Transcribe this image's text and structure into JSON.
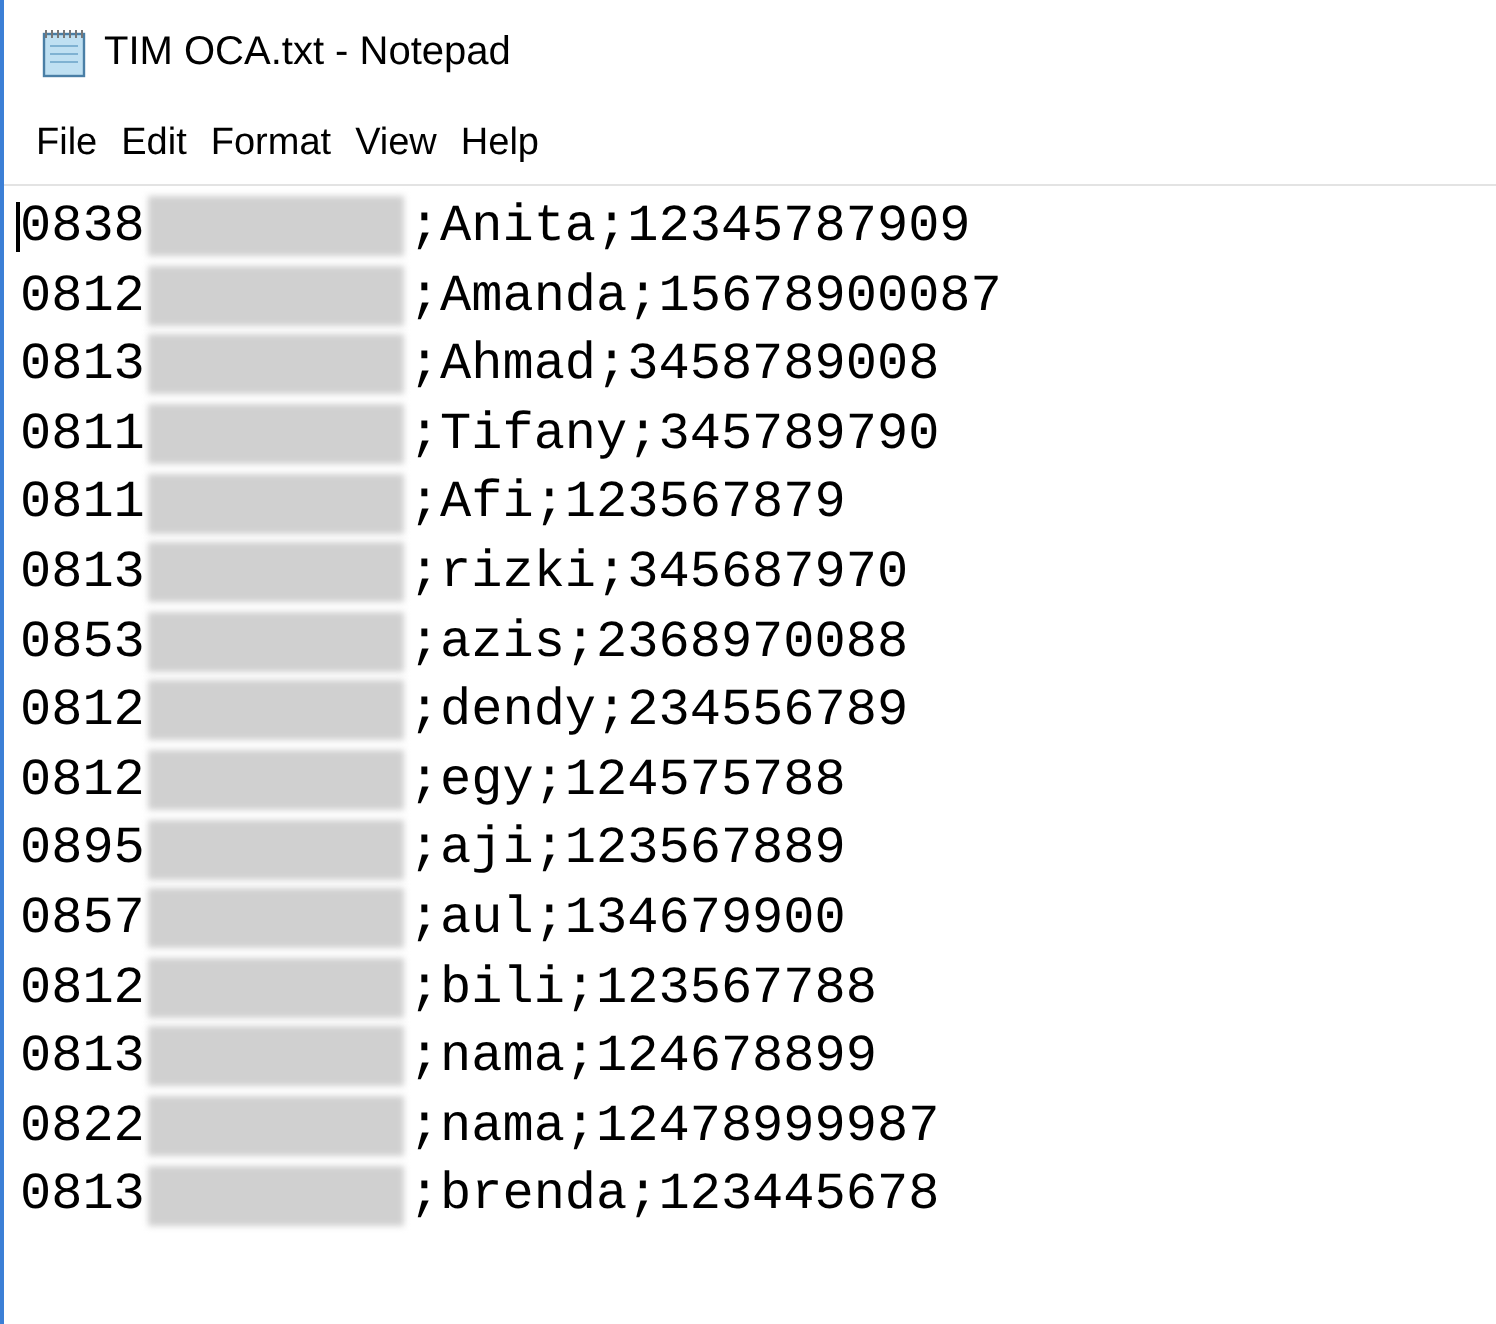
{
  "window": {
    "title": "TIM OCA.txt - Notepad"
  },
  "menu": [
    "File",
    "Edit",
    "Format",
    "View",
    "Help"
  ],
  "lines": [
    {
      "prefix": "0838",
      "redacted": true,
      "suffix": ";Anita;12345787909"
    },
    {
      "prefix": "0812",
      "redacted": true,
      "suffix": ";Amanda;15678900087"
    },
    {
      "prefix": "0813",
      "redacted": true,
      "suffix": ";Ahmad;3458789008"
    },
    {
      "prefix": "0811",
      "redacted": true,
      "suffix": ";Tifany;345789790"
    },
    {
      "prefix": "0811",
      "redacted": true,
      "suffix": ";Afi;123567879"
    },
    {
      "prefix": "0813",
      "redacted": true,
      "suffix": ";rizki;345687970"
    },
    {
      "prefix": "0853",
      "redacted": true,
      "suffix": ";azis;2368970088"
    },
    {
      "prefix": "0812",
      "redacted": true,
      "suffix": ";dendy;234556789"
    },
    {
      "prefix": "0812",
      "redacted": true,
      "suffix": ";egy;124575788"
    },
    {
      "prefix": "0895",
      "redacted": true,
      "suffix": ";aji;123567889"
    },
    {
      "prefix": "0857",
      "redacted": true,
      "suffix": ";aul;134679900"
    },
    {
      "prefix": "0812",
      "redacted": true,
      "suffix": ";bili;123567788"
    },
    {
      "prefix": "0813",
      "redacted": true,
      "suffix": ";nama;124678899"
    },
    {
      "prefix": "0822",
      "redacted": true,
      "suffix": ";nama;12478999987"
    },
    {
      "prefix": "0813",
      "redacted": true,
      "suffix": ";brenda;123445678"
    }
  ]
}
